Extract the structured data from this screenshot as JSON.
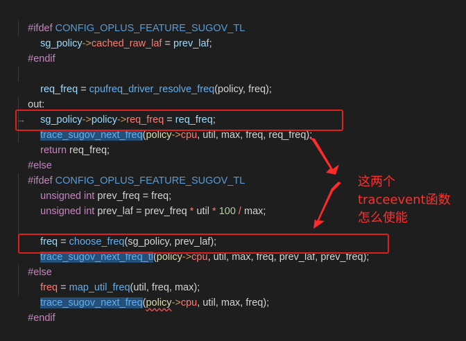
{
  "code": {
    "l1": {
      "pp": "#ifdef",
      "macro": "CONFIG_OPLUS_FEATURE_SUGOV_TL"
    },
    "l2": {
      "a": "sg_policy",
      "arrow": "->",
      "b": "cached_raw_laf",
      "eq": " = ",
      "c": "prev_laf",
      "end": ";"
    },
    "l3": {
      "pp": "#endif"
    },
    "l5": {
      "a": "req_freq",
      "eq": " = ",
      "fn": "cpufreq_driver_resolve_freq",
      "args": "(policy, freq);"
    },
    "l6": {
      "label": "out:"
    },
    "l7": {
      "a": "sg_policy",
      "arrow1": "->",
      "b": "policy",
      "arrow2": "->",
      "c": "req_freq",
      "eq": " = ",
      "d": "req_freq",
      "end": ";"
    },
    "l8": {
      "fn": "trace_sugov_next_freq",
      "open": "(",
      "p": "policy",
      "arrow": "->",
      "cpu": "cpu",
      "rest": ", util, max, freq, req_freq);"
    },
    "l9": {
      "kw": "return",
      "rest": " req_freq;"
    },
    "l10": {
      "pp": "#else"
    },
    "l11": {
      "pp": "#ifdef",
      "macro": "CONFIG_OPLUS_FEATURE_SUGOV_TL"
    },
    "l12": {
      "t1": "unsigned",
      "t2": " int",
      "rest": " prev_freq = freq;"
    },
    "l13": {
      "t1": "unsigned",
      "t2": " int",
      "a": " prev_laf = prev_freq ",
      "op1": "*",
      "b": " util ",
      "op2": "*",
      "num": " 100",
      "op3": " /",
      "c": " max;"
    },
    "l15": {
      "a": "freq",
      "eq": " = ",
      "fn": "choose_freq",
      "args": "(sg_policy, prev_laf);"
    },
    "l16": {
      "fn": "trace_sugov_next_freq_tl",
      "open": "(",
      "p": "policy",
      "arrow": "->",
      "cpu": "cpu",
      "rest": ", util, max, freq, prev_laf, prev_freq);"
    },
    "l17": {
      "pp": "#else"
    },
    "l18": {
      "a": "freq",
      "eq": " = ",
      "fn": "map_util_freq",
      "args": "(util, freq, max);"
    },
    "l19": {
      "fn": "trace_sugov_next_freq",
      "open": "(",
      "p": "policy",
      "arrow": "->",
      "cpu": "cpu",
      "rest": ", util, max, freq);"
    },
    "l20": {
      "pp": "#endif"
    }
  },
  "annotation": {
    "line1": "这两个",
    "line2": "traceevent函数",
    "line3": "怎么使能"
  },
  "colors": {
    "highlight_box": "#e02020",
    "annotation": "#ff3030"
  }
}
